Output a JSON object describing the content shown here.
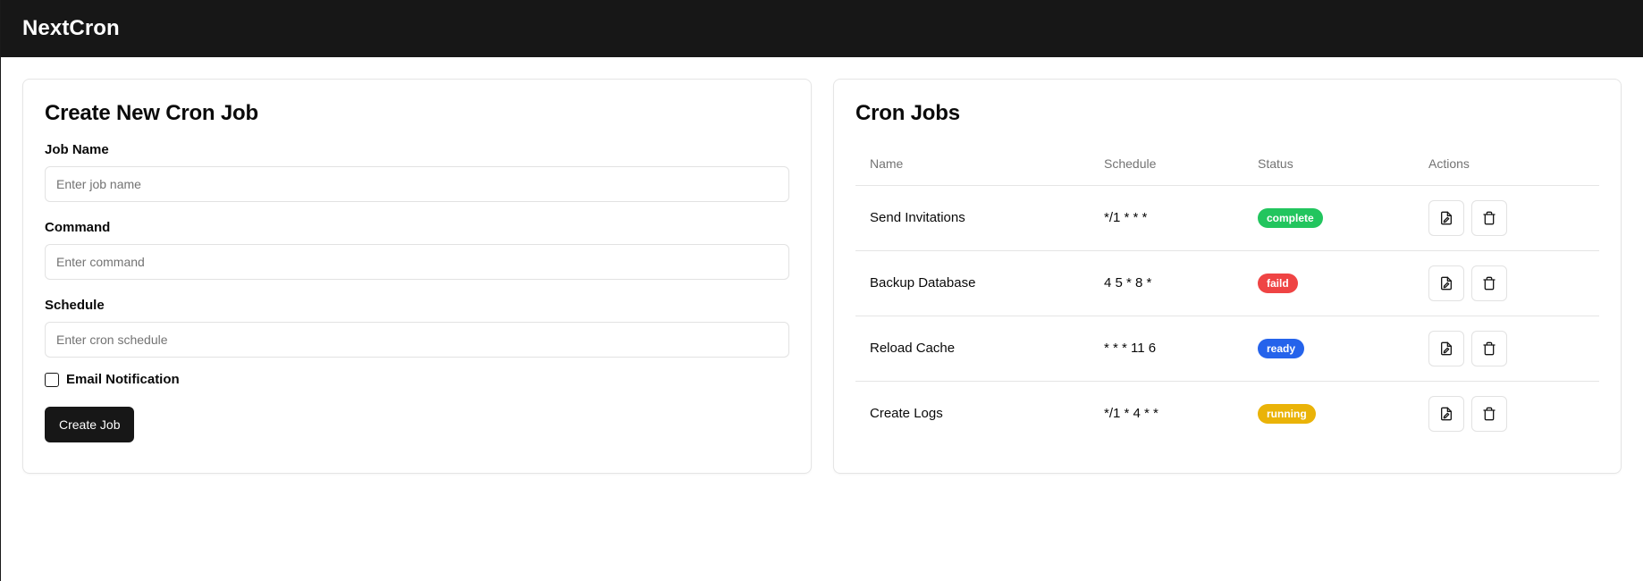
{
  "header": {
    "brand": "NextCron"
  },
  "create_form": {
    "title": "Create New Cron Job",
    "job_name": {
      "label": "Job Name",
      "value": "",
      "placeholder": "Enter job name"
    },
    "command": {
      "label": "Command",
      "value": "",
      "placeholder": "Enter command"
    },
    "schedule": {
      "label": "Schedule",
      "value": "",
      "placeholder": "Enter cron schedule"
    },
    "email_notification": {
      "label": "Email Notification",
      "checked": false
    },
    "submit_label": "Create Job"
  },
  "jobs_panel": {
    "title": "Cron Jobs",
    "columns": [
      "Name",
      "Schedule",
      "Status",
      "Actions"
    ],
    "rows": [
      {
        "name": "Send Invitations",
        "schedule": "*/1 * * *",
        "status": "complete",
        "status_color": "#22c55e",
        "actions": [
          "edit-icon",
          "trash-icon"
        ]
      },
      {
        "name": "Backup Database",
        "schedule": "4 5 * 8 *",
        "status": "faild",
        "status_color": "#ef4444",
        "actions": [
          "edit-icon",
          "trash-icon"
        ]
      },
      {
        "name": "Reload Cache",
        "schedule": "* * * 11 6",
        "status": "ready",
        "status_color": "#2563eb",
        "actions": [
          "edit-icon",
          "trash-icon"
        ]
      },
      {
        "name": "Create Logs",
        "schedule": "*/1 * 4 * *",
        "status": "running",
        "status_color": "#eab308",
        "actions": [
          "edit-icon",
          "trash-icon"
        ]
      }
    ]
  },
  "colors": {
    "topbar": "#171717",
    "primary_button": "#171717",
    "border": "#e5e5e5"
  }
}
